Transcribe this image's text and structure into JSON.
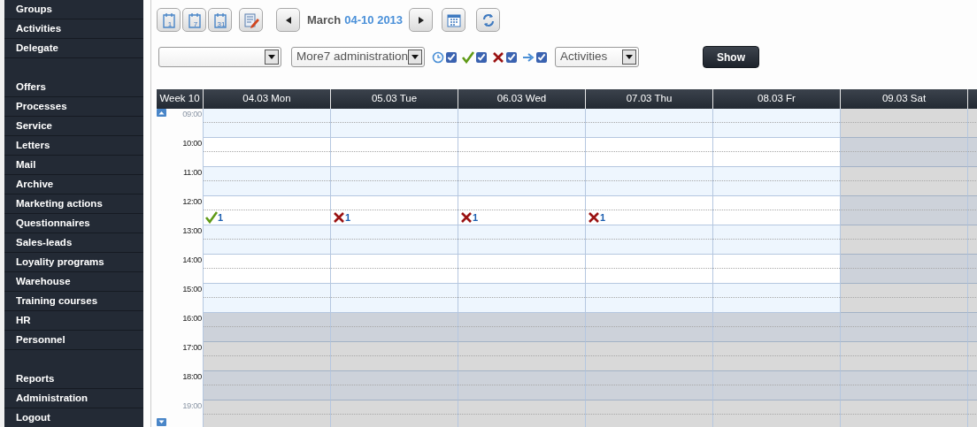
{
  "sidebar": {
    "sections": [
      [
        {
          "label": "Groups"
        },
        {
          "label": "Activities"
        },
        {
          "label": "Delegate"
        }
      ],
      [
        {
          "label": "Offers"
        },
        {
          "label": "Processes"
        },
        {
          "label": "Service"
        },
        {
          "label": "Letters"
        },
        {
          "label": "Mail"
        },
        {
          "label": "Archive"
        },
        {
          "label": "Marketing actions"
        },
        {
          "label": "Questionnaires"
        },
        {
          "label": "Sales-leads"
        },
        {
          "label": "Loyality programs"
        },
        {
          "label": "Warehouse"
        },
        {
          "label": "Training courses"
        },
        {
          "label": "HR"
        },
        {
          "label": "Personnel"
        }
      ],
      [
        {
          "label": "Reports"
        },
        {
          "label": "Administration"
        },
        {
          "label": "Logout"
        }
      ]
    ]
  },
  "toolbar": {
    "view_buttons": [
      {
        "label": "1"
      },
      {
        "label": "7"
      },
      {
        "label": "31"
      }
    ],
    "period": {
      "month": "March",
      "range": "04-10 2013"
    }
  },
  "filters": {
    "dropdowns": [
      {
        "kind": "blank"
      },
      {
        "kind": "text",
        "value": "More7 administration"
      }
    ],
    "status_toggles": [
      {
        "kind": "pending",
        "checked": true
      },
      {
        "kind": "done",
        "checked": true
      },
      {
        "kind": "cancelled",
        "checked": true
      },
      {
        "kind": "forwarded",
        "checked": true
      }
    ],
    "type_dropdown": {
      "value": "Activities"
    },
    "show_button": "Show"
  },
  "calendar": {
    "week_label": "Week 10",
    "days": [
      {
        "label": "04.03 Mon",
        "weekend": false
      },
      {
        "label": "05.03 Tue",
        "weekend": false
      },
      {
        "label": "06.03 Wed",
        "weekend": false
      },
      {
        "label": "07.03 Thu",
        "weekend": false
      },
      {
        "label": "08.03 Fr",
        "weekend": false
      },
      {
        "label": "09.03 Sat",
        "weekend": true
      }
    ],
    "hours": [
      {
        "label": "09:00",
        "off": false,
        "dim": true
      },
      {
        "label": "10:00",
        "off": false,
        "dim": false
      },
      {
        "label": "11:00",
        "off": false,
        "dim": false
      },
      {
        "label": "12:00",
        "off": false,
        "dim": false,
        "late_half_events": [
          {
            "kind": "done",
            "count": "1"
          },
          {
            "kind": "cancelled",
            "count": "1"
          },
          {
            "kind": "cancelled",
            "count": "1"
          },
          {
            "kind": "cancelled",
            "count": "1"
          }
        ]
      },
      {
        "label": "13:00",
        "off": false,
        "dim": false
      },
      {
        "label": "14:00",
        "off": false,
        "dim": false
      },
      {
        "label": "15:00",
        "off": false,
        "dim": false
      },
      {
        "label": "16:00",
        "off": true,
        "dim": false
      },
      {
        "label": "17:00",
        "off": true,
        "dim": false
      },
      {
        "label": "18:00",
        "off": true,
        "dim": false
      },
      {
        "label": "19:00",
        "off": true,
        "dim": true
      }
    ]
  }
}
